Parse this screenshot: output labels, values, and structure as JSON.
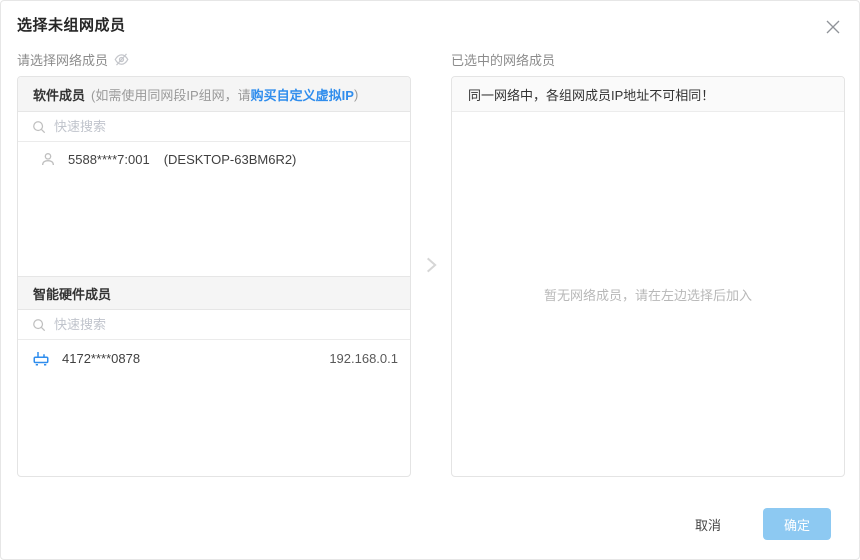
{
  "dialog": {
    "title": "选择未组网成员"
  },
  "left": {
    "label": "请选择网络成员",
    "software": {
      "header_bold": "软件成员",
      "header_note_prefix": "(如需使用同网段IP组网，请 ",
      "header_link": "购买自定义虚拟IP",
      "header_note_suffix": " )",
      "search_placeholder": "快速搜索",
      "members": [
        {
          "id": "5588****7:001",
          "name": "(DESKTOP-63BM6R2)"
        }
      ]
    },
    "hardware": {
      "header": "智能硬件成员",
      "search_placeholder": "快速搜索",
      "members": [
        {
          "id": "4172****0878",
          "ip": "192.168.0.1"
        }
      ]
    }
  },
  "right": {
    "label": "已选中的网络成员",
    "notice": "同一网络中，各组网成员IP地址不可相同！",
    "empty_text": "暂无网络成员，请在左边选择后加入"
  },
  "footer": {
    "cancel_label": "取消",
    "confirm_label": "确定"
  },
  "colors": {
    "link_blue": "#2f8ded",
    "confirm_button_bg": "#8dc9f2",
    "section_header_bg": "#f5f5f5",
    "panel_border": "#e4e4e4",
    "icon_gray": "#bfbfbf",
    "router_icon_blue": "#2f8ded"
  }
}
